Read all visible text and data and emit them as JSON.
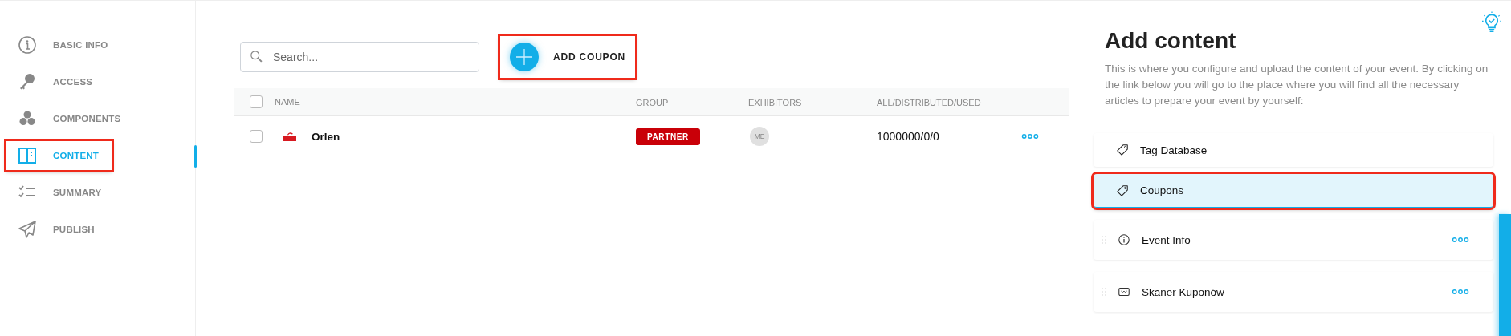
{
  "sidebar": {
    "items": [
      {
        "label": "BASIC INFO",
        "selected": false,
        "highlighted": false
      },
      {
        "label": "ACCESS",
        "selected": false,
        "highlighted": false
      },
      {
        "label": "COMPONENTS",
        "selected": false,
        "highlighted": false
      },
      {
        "label": "CONTENT",
        "selected": true,
        "highlighted": true
      },
      {
        "label": "SUMMARY",
        "selected": false,
        "highlighted": false
      },
      {
        "label": "PUBLISH",
        "selected": false,
        "highlighted": false
      }
    ]
  },
  "toolbar": {
    "search": {
      "placeholder": "Search..."
    },
    "add_button": {
      "label": "ADD COUPON",
      "highlighted": true
    }
  },
  "table": {
    "all_checked": false,
    "columns": [
      "NAME",
      "GROUP",
      "EXHIBITORS",
      "ALL/DISTRIBUTED/USED"
    ],
    "rows": [
      {
        "checked": false,
        "name": "Orlen",
        "group": "PARTNER",
        "exhibitor": "ME",
        "counts": "1000000/0/0"
      }
    ]
  },
  "panel": {
    "title": "Add content",
    "description": "This is where you configure and upload the content of your event. By clicking on the link below you will go to the place where you will find all the necessary articles to prepare your event by yourself:",
    "items": [
      {
        "kind": "link",
        "label": "Tag Database",
        "selected": false,
        "highlighted": false
      },
      {
        "kind": "link",
        "label": "Coupons",
        "selected": true,
        "highlighted": true
      },
      {
        "kind": "module",
        "label": "Event Info",
        "selected": false,
        "highlighted": false
      },
      {
        "kind": "module",
        "label": "Skaner Kuponów",
        "selected": false,
        "highlighted": false
      }
    ]
  }
}
